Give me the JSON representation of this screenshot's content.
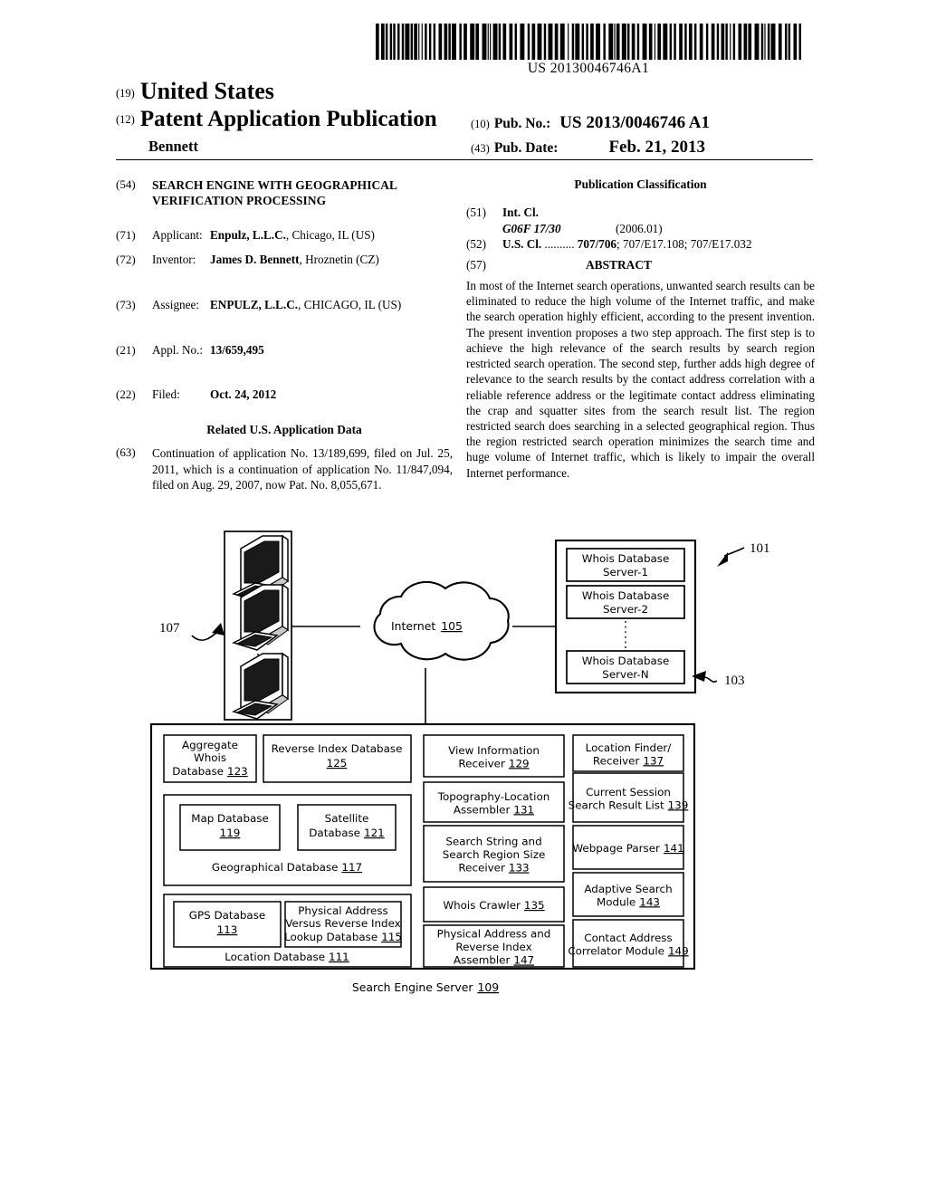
{
  "barcode": {
    "number": "US 20130046746A1"
  },
  "header": {
    "code_19": "(19)",
    "country": "United States",
    "code_12": "(12)",
    "doc_type": "Patent Application Publication",
    "inventor_surname": "Bennett",
    "code_10": "(10)",
    "pubno_label": "Pub. No.:",
    "pubno_value": "US 2013/0046746 A1",
    "code_43": "(43)",
    "pubdate_label": "Pub. Date:",
    "pubdate_value": "Feb. 21, 2013"
  },
  "left_column": {
    "title_code": "(54)",
    "title": "SEARCH ENGINE WITH GEOGRAPHICAL VERIFICATION PROCESSING",
    "applicant_code": "(71)",
    "applicant_label": "Applicant:",
    "applicant_name": "Enpulz, L.L.C.",
    "applicant_rest": ", Chicago, IL (US)",
    "inventor_code": "(72)",
    "inventor_label": "Inventor:",
    "inventor_name": "James D. Bennett",
    "inventor_rest": ", Hroznetin (CZ)",
    "assignee_code": "(73)",
    "assignee_label": "Assignee:",
    "assignee_name": "ENPULZ, L.L.C.",
    "assignee_rest": ", CHICAGO, IL (US)",
    "applno_code": "(21)",
    "applno_label": "Appl. No.:",
    "applno_value": "13/659,495",
    "filed_code": "(22)",
    "filed_label": "Filed:",
    "filed_value": "Oct. 24, 2012",
    "related_head": "Related U.S. Application Data",
    "related_code": "(63)",
    "related_text": "Continuation of application No. 13/189,699, filed on Jul. 25, 2011, which is a continuation of application No. 11/847,094, filed on Aug. 29, 2007, now Pat. No. 8,055,671."
  },
  "right_column": {
    "classification_head": "Publication Classification",
    "intcl_code": "(51)",
    "intcl_label": "Int. Cl.",
    "intcl_class": "G06F 17/30",
    "intcl_version": "(2006.01)",
    "uscl_code": "(52)",
    "uscl_label": "U.S. Cl.",
    "uscl_dots": "..........",
    "uscl_primary": "707/706",
    "uscl_rest": "; 707/E17.108; 707/E17.032",
    "abstract_code": "(57)",
    "abstract_head": "ABSTRACT",
    "abstract_text": "In most of the Internet search operations, unwanted search results can be eliminated to reduce the high volume of the Internet traffic, and make the search operation highly efficient, according to the present invention. The present invention proposes a two step approach. The first step is to achieve the high relevance of the search results by search region restricted search operation. The second step, further adds high degree of relevance to the search results by the contact address correlation with a reliable reference address or the legitimate contact address eliminating the crap and squatter sites from the search result list. The region restricted search does searching in a selected geographical region. Thus the region restricted search operation minimizes the search time and huge volume of Internet traffic, which is likely to impair the overall Internet performance."
  },
  "figure": {
    "ref_107": "107",
    "ref_101": "101",
    "ref_103": "103",
    "cloud_label": "Internet",
    "cloud_num": "105",
    "whois_servers": [
      {
        "line1": "Whois Database",
        "line2": "Server-1"
      },
      {
        "line1": "Whois Database",
        "line2": "Server-2"
      },
      {
        "line1": "Whois Database",
        "line2": "Server-N"
      }
    ],
    "server_block": {
      "caption_label": "Search Engine Server",
      "caption_num": "109",
      "aggregate_whois": {
        "l1": "Aggregate",
        "l2": "Whois",
        "l3": "Database",
        "num": "123"
      },
      "reverse_index": {
        "l1": "Reverse Index Database",
        "num": "125"
      },
      "geo_db": {
        "label": "Geographical Database",
        "num": "117"
      },
      "map_db": {
        "l1": "Map Database",
        "num": "119"
      },
      "satellite_db": {
        "l1": "Satellite",
        "l2": "Database",
        "num": "121"
      },
      "location_db": {
        "label": "Location Database",
        "num": "111"
      },
      "gps_db": {
        "l1": "GPS Database",
        "num": "113"
      },
      "phys_lookup": {
        "l1": "Physical Address",
        "l2": "Versus Reverse Index",
        "l3": "Lookup Database",
        "num": "115"
      },
      "middle_column": [
        {
          "lines": [
            "View Information",
            "Receiver"
          ],
          "num": "129"
        },
        {
          "lines": [
            "Topography-Location",
            "Assembler"
          ],
          "num": "131"
        },
        {
          "lines": [
            "Search String and",
            "Search Region Size",
            "Receiver"
          ],
          "num": "133"
        },
        {
          "lines": [
            "Whois Crawler"
          ],
          "num": "135"
        },
        {
          "lines": [
            "Physical Address and",
            "Reverse Index",
            "Assembler"
          ],
          "num": "147"
        }
      ],
      "right_column": [
        {
          "lines": [
            "Location Finder/",
            "Receiver"
          ],
          "num": "137"
        },
        {
          "lines": [
            "Current Session",
            "Search Result List"
          ],
          "num": "139"
        },
        {
          "lines": [
            "Webpage Parser"
          ],
          "num": "141"
        },
        {
          "lines": [
            "Adaptive Search",
            "Module"
          ],
          "num": "143"
        },
        {
          "lines": [
            "Contact Address",
            "Correlator Module"
          ],
          "num": "149"
        }
      ]
    }
  }
}
